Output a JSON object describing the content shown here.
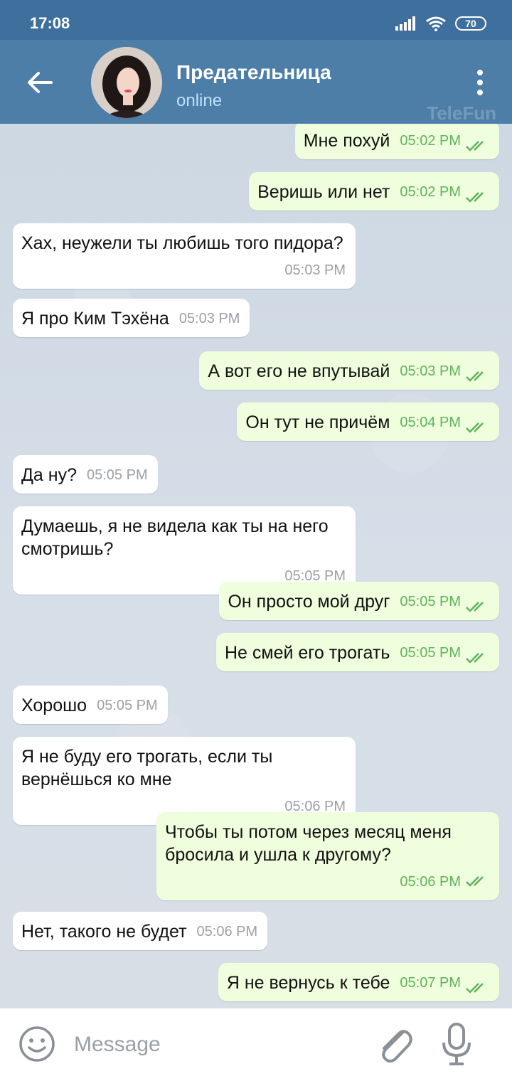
{
  "status_bar": {
    "time": "17:08",
    "battery": "70"
  },
  "header": {
    "title": "Предательница",
    "subtitle": "online",
    "watermark": "TeleFun"
  },
  "messages": [
    {
      "dir": "out",
      "text": "Мне похуй",
      "time": "05:02 PM"
    },
    {
      "dir": "out",
      "text": "Веришь или нет",
      "time": "05:02 PM"
    },
    {
      "dir": "in",
      "text": "Хах, неужели ты любишь того пидора?",
      "time": "05:03 PM"
    },
    {
      "dir": "in",
      "text": "Я про Ким Тэхёна",
      "time": "05:03 PM"
    },
    {
      "dir": "out",
      "text": "А вот его не впутывай",
      "time": "05:03 PM"
    },
    {
      "dir": "out",
      "text": "Он тут не причём",
      "time": "05:04 PM"
    },
    {
      "dir": "in",
      "text": "Да ну?",
      "time": "05:05 PM"
    },
    {
      "dir": "in",
      "text": "Думаешь, я не видела как ты на него смотришь?",
      "time": "05:05 PM"
    },
    {
      "dir": "out",
      "text": "Он просто мой друг",
      "time": "05:05 PM"
    },
    {
      "dir": "out",
      "text": "Не смей его трогать",
      "time": "05:05 PM"
    },
    {
      "dir": "in",
      "text": "Хорошо",
      "time": "05:05 PM"
    },
    {
      "dir": "in",
      "text": "Я не буду его трогать, если ты вернёшься ко мне",
      "time": "05:06 PM"
    },
    {
      "dir": "out",
      "text": "Чтобы ты потом через месяц меня бросила и ушла к другому?",
      "time": "05:06 PM"
    },
    {
      "dir": "in",
      "text": "Нет, такого не будет",
      "time": "05:06 PM"
    },
    {
      "dir": "out",
      "text": "Я не вернусь к тебе",
      "time": "05:07 PM"
    }
  ],
  "input": {
    "placeholder": "Message"
  },
  "colors": {
    "header": "#4d7ea8",
    "status_bar": "#3f6f9c",
    "outgoing_bubble": "#effedd",
    "incoming_bubble": "#ffffff",
    "check_green": "#5fb35a"
  }
}
